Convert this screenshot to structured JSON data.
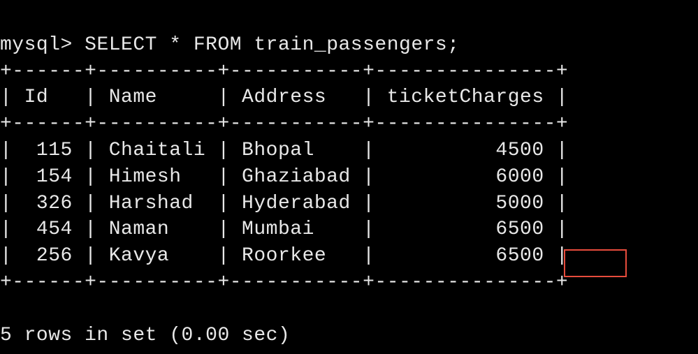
{
  "prompt": "mysql>",
  "query": "SELECT * FROM train_passengers;",
  "table": {
    "border_top": "+------+----------+-----------+---------------+",
    "header_line": "| Id   | Name     | Address   | ticketCharges |",
    "border_mid": "+------+----------+-----------+---------------+",
    "headers": [
      "Id",
      "Name",
      "Address",
      "ticketCharges"
    ],
    "rows": [
      {
        "Id": 115,
        "Name": "Chaitali",
        "Address": "Bhopal",
        "ticketCharges": 4500,
        "line": "|  115 | Chaitali | Bhopal    |          4500 |"
      },
      {
        "Id": 154,
        "Name": "Himesh",
        "Address": "Ghaziabad",
        "ticketCharges": 6000,
        "line": "|  154 | Himesh   | Ghaziabad |          6000 |"
      },
      {
        "Id": 326,
        "Name": "Harshad",
        "Address": "Hyderabad",
        "ticketCharges": 5000,
        "line": "|  326 | Harshad  | Hyderabad |          5000 |"
      },
      {
        "Id": 454,
        "Name": "Naman",
        "Address": "Mumbai",
        "ticketCharges": 6500,
        "line": "|  454 | Naman    | Mumbai    |          6500 |"
      },
      {
        "Id": 256,
        "Name": "Kavya",
        "Address": "Roorkee",
        "ticketCharges": 6500,
        "line": "|  256 | Kavya    | Roorkee   |          6500 |"
      }
    ],
    "border_bot": "+------+----------+-----------+---------------+"
  },
  "footer": "5 rows in set (0.00 sec)",
  "highlight": {
    "row_index": 4,
    "column": "ticketCharges",
    "value": 6500
  }
}
